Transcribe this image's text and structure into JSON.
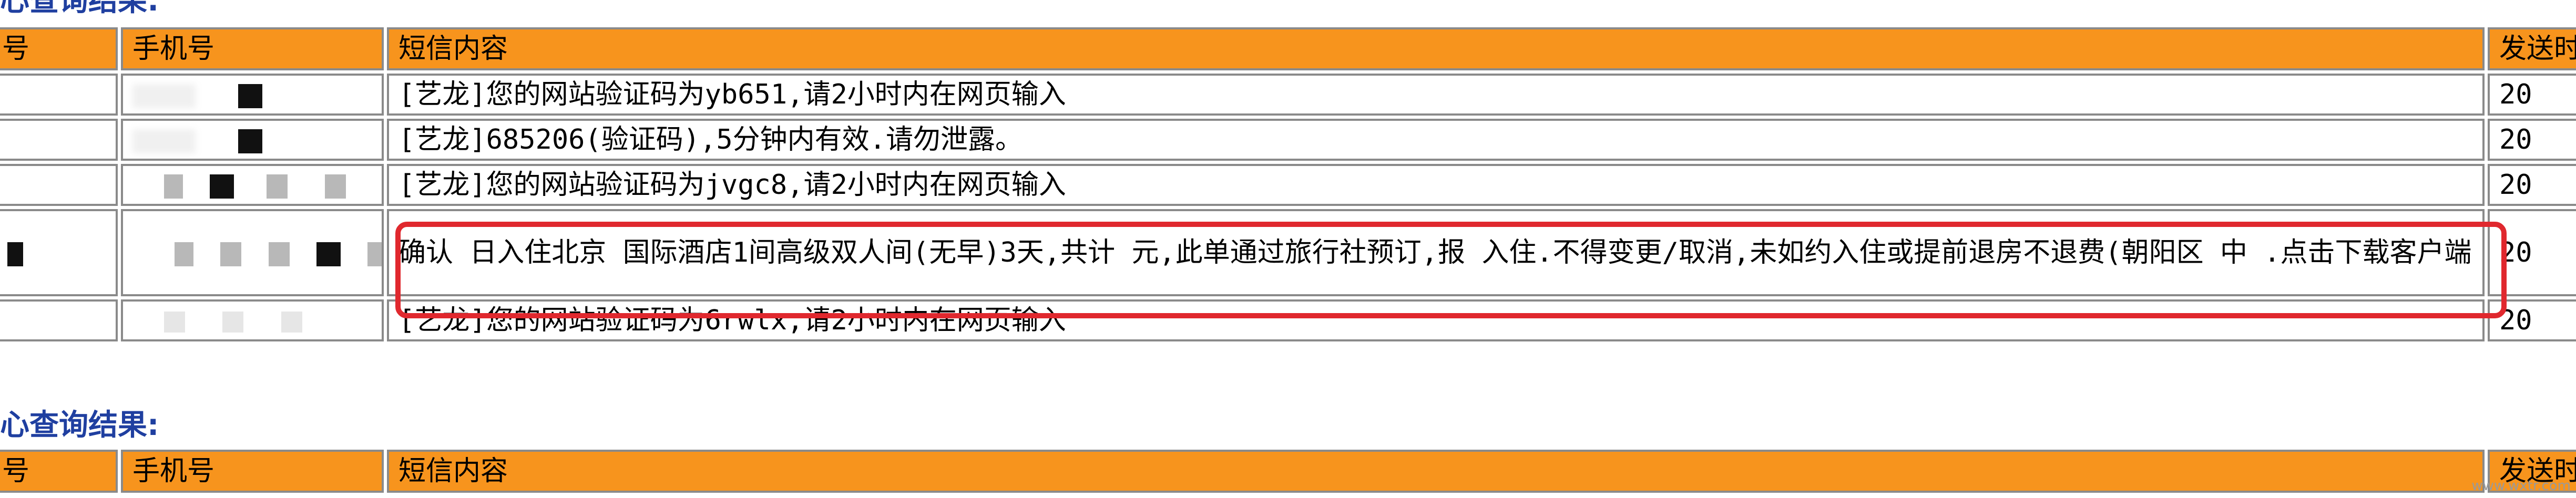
{
  "sections": [
    {
      "title": "心查询结果:",
      "headers": [
        "号",
        "手机号",
        "短信内容",
        "发送时"
      ],
      "rows": [
        {
          "content": "[艺龙]您的网站验证码为yb651,请2小时内在网页输入",
          "time": "20"
        },
        {
          "content": "[艺龙]685206(验证码),5分钟内有效.请勿泄露。",
          "time": "20"
        },
        {
          "content": "[艺龙]您的网站验证码为jvgc8,请2小时内在网页输入",
          "time": "20"
        },
        {
          "content": "确认 日入住北京 国际酒店1间高级双人间(无早)3天,共计 元,此单通过旅行社预订,报 入住.不得变更/取消,未如约入住或提前退房不退费(朝阳区 中 .点击下载客户端 http://d.elong.cn/cch 订单查询变更取消,酒店位置路线导航更方便",
          "time": "20"
        },
        {
          "content": "[艺龙]您的网站验证码为6rwlx,请2小时内在网页输入",
          "time": "20"
        }
      ]
    },
    {
      "title": "心查询结果:",
      "headers": [
        "号",
        "手机号",
        "短信内容",
        "发送时"
      ]
    }
  ],
  "watermark": "www.wxtr.com",
  "colors": {
    "header_bg": "#f7941d",
    "highlight": "#e0282e",
    "title": "#1f3fa0"
  }
}
